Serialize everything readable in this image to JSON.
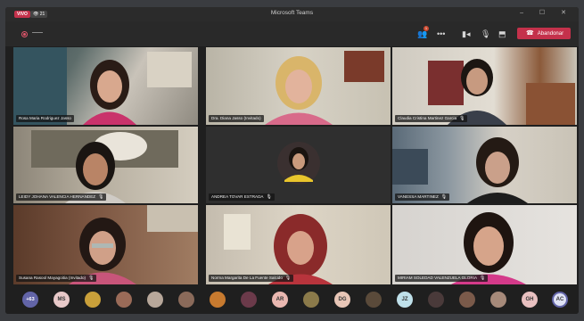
{
  "titlebar": {
    "live_badge": "VIVO",
    "viewer_count": "21",
    "app_title": "Microsoft Teams",
    "window_controls": "– ☐ ✕"
  },
  "toolbar": {
    "notification_count": "1",
    "leave_button_label": "Abandonar"
  },
  "participants": [
    {
      "name": "Rosa Maria Rodriguez Jasso",
      "muted": false
    },
    {
      "name": "Dra. Diana Jasso (Invitado)",
      "muted": false
    },
    {
      "name": "Claudia Cristina Martinez Garcia",
      "muted": true
    },
    {
      "name": "LEIDY JOHANA VALENCIA HERNANDEZ",
      "muted": true
    },
    {
      "name": "ANDREA TOVAR ESTRADA",
      "muted": true
    },
    {
      "name": "VANESSA MARTINEZ",
      "muted": true
    },
    {
      "name": "Susana Rasool Mayagoitia (Invitado)",
      "muted": true
    },
    {
      "name": "Norma Margarita De La Fuente Salcido",
      "muted": true
    },
    {
      "name": "MIRIAM SOLEDAD VALENZUELA GLORIA",
      "muted": true
    }
  ],
  "strip": {
    "overflow_count": "+63",
    "initials": [
      "MS",
      "AR",
      "DG",
      "JZ",
      "GH",
      "AC"
    ]
  },
  "colors": {
    "accent_red": "#c4314b",
    "teams_purple": "#6264a7"
  }
}
